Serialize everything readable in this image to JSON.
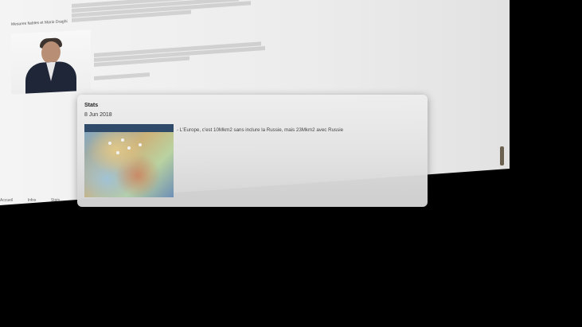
{
  "card": {
    "title": "Stats",
    "date": "8 Jun 2018",
    "text": "- L'Europe, c'est 10Mkm2 sans inclure la Russie, mais 23Mkm2 avec Russie",
    "image": "europe-map-with-pins"
  },
  "background_page": {
    "author_caption": "Mesures fiables et Mario Draghi",
    "photo": "mario-draghi-portrait",
    "footer_items": [
      "Accueil",
      "Infos",
      "Stats"
    ]
  }
}
